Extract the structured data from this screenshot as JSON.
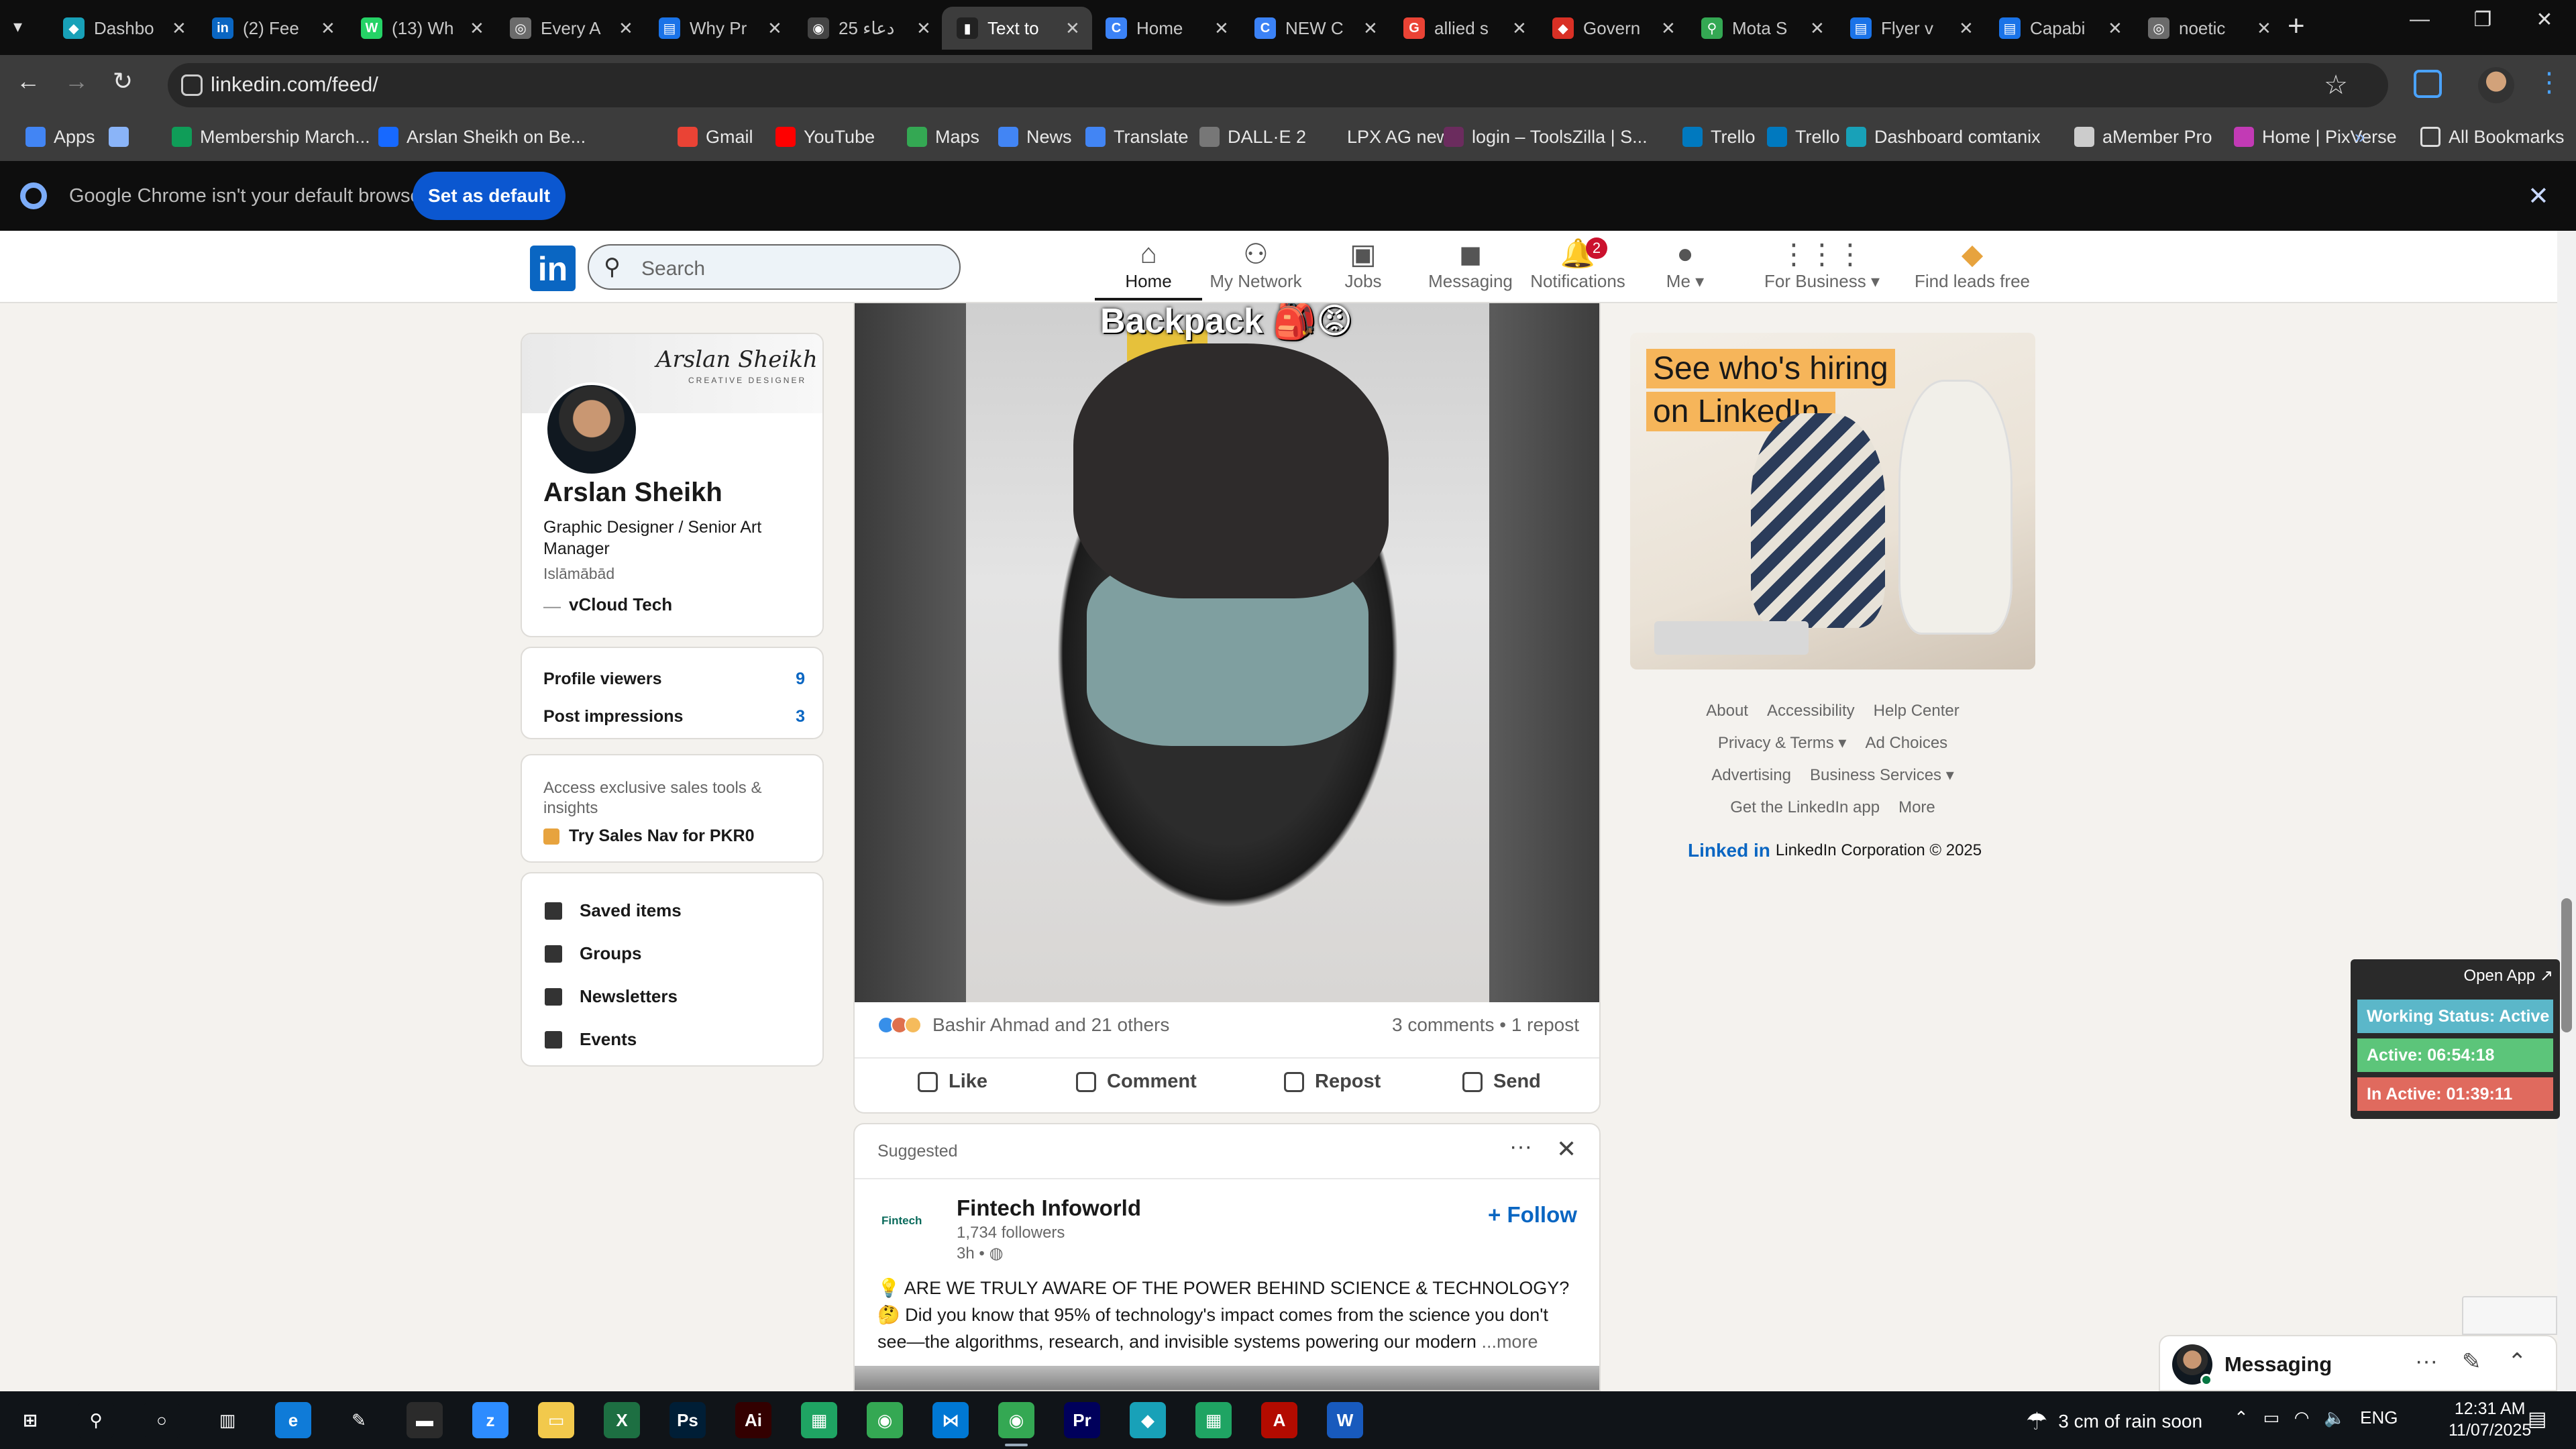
{
  "browser": {
    "tabs": [
      {
        "title": "Dashbo",
        "color": "#18a1b8",
        "glyph": "◆"
      },
      {
        "title": "(2) Fee",
        "color": "#0a66c2",
        "glyph": "in"
      },
      {
        "title": "(13) Wh",
        "color": "#25d366",
        "glyph": "W"
      },
      {
        "title": "Every A",
        "color": "#6b6b6b",
        "glyph": "◎"
      },
      {
        "title": "Why Pr",
        "color": "#1a73e8",
        "glyph": "▤"
      },
      {
        "title": "25 دعاء",
        "color": "#444444",
        "glyph": "◉"
      },
      {
        "title": "Text to",
        "color": "#222222",
        "glyph": "▮"
      },
      {
        "title": "Home",
        "color": "#3b82f6",
        "glyph": "C"
      },
      {
        "title": "NEW C",
        "color": "#3b82f6",
        "glyph": "C"
      },
      {
        "title": "allied s",
        "color": "#ea4335",
        "glyph": "G"
      },
      {
        "title": "Govern",
        "color": "#d93025",
        "glyph": "◆"
      },
      {
        "title": "Mota S",
        "color": "#34a853",
        "glyph": "⚲"
      },
      {
        "title": "Flyer v",
        "color": "#1a73e8",
        "glyph": "▤"
      },
      {
        "title": "Capabi",
        "color": "#1a73e8",
        "glyph": "▤"
      },
      {
        "title": "noetic",
        "color": "#6b6b6b",
        "glyph": "◎"
      }
    ],
    "active_tab_index": 6,
    "url": "linkedin.com/feed/",
    "bookmarks": [
      {
        "label": "Apps",
        "color": "#4285f4"
      },
      {
        "label": "",
        "color": "#8ab4f8"
      },
      {
        "label": "Membership March...",
        "color": "#0f9d58"
      },
      {
        "label": "Arslan Sheikh on Be...",
        "color": "#1769ff"
      },
      {
        "label": "Gmail",
        "color": "#ea4335"
      },
      {
        "label": "YouTube",
        "color": "#ff0000"
      },
      {
        "label": "Maps",
        "color": "#34a853"
      },
      {
        "label": "News",
        "color": "#4285f4"
      },
      {
        "label": "Translate",
        "color": "#4285f4"
      },
      {
        "label": "DALL·E 2",
        "color": "#777777"
      },
      {
        "label": "LPX AG new",
        "color": "#3c3c3c"
      },
      {
        "label": "login – ToolsZilla | S...",
        "color": "#6b2c5e"
      },
      {
        "label": "Trello",
        "color": "#0079bf"
      },
      {
        "label": "Trello",
        "color": "#0079bf"
      },
      {
        "label": "Dashboard comtanix",
        "color": "#18a1b8"
      },
      {
        "label": "aMember Pro",
        "color": "#cccccc"
      },
      {
        "label": "Home | PixVerse",
        "color": "#c23ab5"
      }
    ],
    "all_bookmarks": "All Bookmarks",
    "infobar_text": "Google Chrome isn't your default browser",
    "set_default_label": "Set as default"
  },
  "linkedin": {
    "search_placeholder": "Search",
    "nav": [
      {
        "label": "Home",
        "icon": "home-icon",
        "active": true
      },
      {
        "label": "My Network",
        "icon": "network-icon"
      },
      {
        "label": "Jobs",
        "icon": "briefcase-icon"
      },
      {
        "label": "Messaging",
        "icon": "chat-icon"
      },
      {
        "label": "Notifications",
        "icon": "bell-icon",
        "badge": "2"
      },
      {
        "label": "Me ▾",
        "icon": "avatar-icon"
      },
      {
        "label": "For Business ▾",
        "icon": "grid-icon"
      },
      {
        "label": "Find leads free",
        "icon": "sales-nav-icon"
      }
    ],
    "profile": {
      "cover_name": "Arslan Sheikh",
      "cover_sub": "CREATIVE DESIGNER",
      "name": "Arslan Sheikh",
      "title": "Graphic Designer / Senior Art Manager",
      "location": "Islāmābād",
      "company_dash": "—",
      "company": "vCloud Tech"
    },
    "stats": [
      {
        "label": "Profile viewers",
        "value": "9"
      },
      {
        "label": "Post impressions",
        "value": "3"
      }
    ],
    "premium": {
      "text": "Access exclusive sales tools & insights",
      "link": "Try Sales Nav for PKR0"
    },
    "shortcuts": [
      {
        "label": "Saved items",
        "icon": "bookmark-icon"
      },
      {
        "label": "Groups",
        "icon": "groups-icon"
      },
      {
        "label": "Newsletters",
        "icon": "newsletter-icon"
      },
      {
        "label": "Events",
        "icon": "calendar-icon"
      }
    ],
    "post": {
      "video_caption": "Backpack 🎒😡",
      "reactions_text": "Bashir Ahmad and 21 others",
      "reaction_colors": [
        "#378fe9",
        "#df704d",
        "#f5bb5c"
      ],
      "comments_text": "3 comments • 1 repost",
      "actions": [
        {
          "label": "Like",
          "icon": "like-icon"
        },
        {
          "label": "Comment",
          "icon": "comment-icon"
        },
        {
          "label": "Repost",
          "icon": "repost-icon"
        },
        {
          "label": "Send",
          "icon": "send-icon"
        }
      ]
    },
    "suggested": {
      "label": "Suggested",
      "company_logo": "Fintech",
      "company": "Fintech Infoworld",
      "followers": "1,734 followers",
      "time": "3h •",
      "follow": "+ Follow",
      "text": "💡 ARE WE TRULY AWARE OF THE POWER BEHIND SCIENCE & TECHNOLOGY? 🤔 Did you know that 95% of technology's impact comes from the science you don't see—the algorithms, research, and invisible systems powering our modern",
      "more": "...more"
    },
    "ad": {
      "line1": "See who's hiring",
      "line2": "on LinkedIn."
    },
    "footer": {
      "row1": [
        "About",
        "Accessibility",
        "Help Center"
      ],
      "row2": [
        "Privacy & Terms ▾",
        "Ad Choices"
      ],
      "row3": [
        "Advertising",
        "Business Services ▾"
      ],
      "row4": [
        "Get the LinkedIn app",
        "More"
      ],
      "corp_logo": "Linked in",
      "corp": "LinkedIn Corporation © 2025"
    },
    "messaging_label": "Messaging"
  },
  "widget": {
    "open_app": "Open App ↗",
    "rows": [
      {
        "text": "Working Status: Active",
        "color": "#5bb7c9"
      },
      {
        "text": "Active: 06:54:18",
        "color": "#5cc57a"
      },
      {
        "text": "In Active: 01:39:11",
        "color": "#e06a5e"
      }
    ]
  },
  "taskbar": {
    "apps": [
      {
        "name": "start-icon",
        "color": "#101418",
        "glyph": "⊞"
      },
      {
        "name": "search-icon",
        "color": "#101418",
        "glyph": "⚲"
      },
      {
        "name": "cortana-icon",
        "color": "#101418",
        "glyph": "○"
      },
      {
        "name": "task-view-icon",
        "color": "#101418",
        "glyph": "▥"
      },
      {
        "name": "edge-icon",
        "color": "#0f7bd8",
        "glyph": "e"
      },
      {
        "name": "pen-icon",
        "color": "#101418",
        "glyph": "✎"
      },
      {
        "name": "terminal-icon",
        "color": "#2b2b2b",
        "glyph": "▬"
      },
      {
        "name": "zoom-icon",
        "color": "#2d8cff",
        "glyph": "z"
      },
      {
        "name": "explorer-icon",
        "color": "#f2c94c",
        "glyph": "▭"
      },
      {
        "name": "excel-icon",
        "color": "#1d6f42",
        "glyph": "X"
      },
      {
        "name": "photoshop-icon",
        "color": "#001e36",
        "glyph": "Ps"
      },
      {
        "name": "illustrator-icon",
        "color": "#330000",
        "glyph": "Ai"
      },
      {
        "name": "sheets-icon",
        "color": "#1fa463",
        "glyph": "▦"
      },
      {
        "name": "chrome-icon",
        "color": "#34a853",
        "glyph": "◉"
      },
      {
        "name": "vscode-icon",
        "color": "#0078d4",
        "glyph": "⋈"
      },
      {
        "name": "chrome-icon",
        "color": "#34a853",
        "glyph": "◉"
      },
      {
        "name": "premiere-icon",
        "color": "#00005b",
        "glyph": "Pr"
      },
      {
        "name": "app-icon",
        "color": "#18a1b8",
        "glyph": "◆"
      },
      {
        "name": "sheets-icon",
        "color": "#1fa463",
        "glyph": "▦"
      },
      {
        "name": "acrobat-icon",
        "color": "#b30b00",
        "glyph": "A"
      },
      {
        "name": "word-icon",
        "color": "#185abd",
        "glyph": "W"
      }
    ],
    "weather": "3 cm of rain soon",
    "lang": "ENG",
    "time": "12:31 AM",
    "date": "11/07/2025"
  }
}
